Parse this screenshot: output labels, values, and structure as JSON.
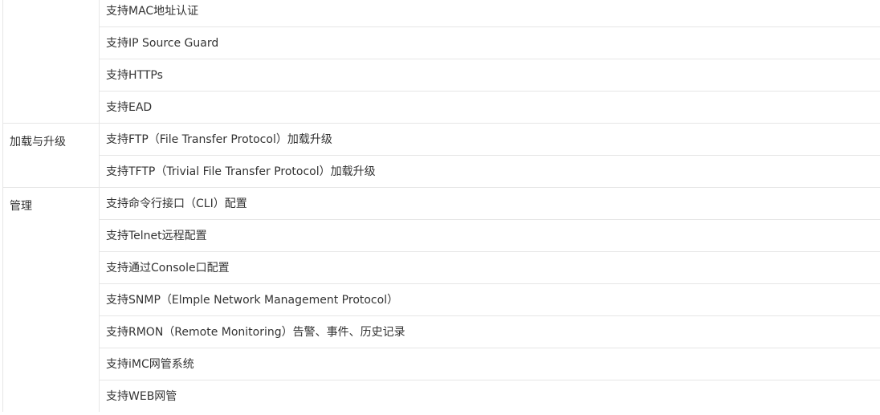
{
  "sections": [
    {
      "category": "",
      "items": [
        "支持MAC地址认证",
        "支持IP Source Guard",
        "支持HTTPs",
        "支持EAD"
      ]
    },
    {
      "category": "加载与升级",
      "items": [
        "支持FTP（File Transfer Protocol）加载升级",
        "支持TFTP（Trivial File Transfer Protocol）加载升级"
      ]
    },
    {
      "category": "管理",
      "items": [
        "支持命令行接口（CLI）配置",
        "支持Telnet远程配置",
        "支持通过Console口配置",
        "支持SNMP（Elmple Network Management Protocol）",
        "支持RMON（Remote Monitoring）告警、事件、历史记录",
        "支持iMC网管系统",
        "支持WEB网管"
      ]
    }
  ]
}
